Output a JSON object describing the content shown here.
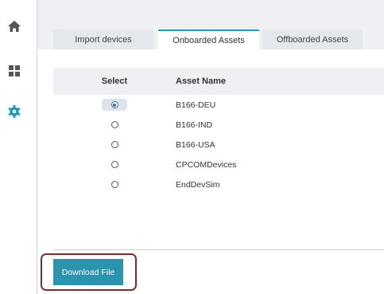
{
  "sidebar": {
    "items": [
      {
        "icon": "home-icon"
      },
      {
        "icon": "dashboard-icon"
      },
      {
        "icon": "gear-icon",
        "active_color": "#1a9bb5"
      }
    ]
  },
  "tabs": [
    {
      "label": "Import devices",
      "active": false
    },
    {
      "label": "Onboarded Assets",
      "active": true
    },
    {
      "label": "Offboarded Assets",
      "active": false
    }
  ],
  "table": {
    "headers": {
      "select": "Select",
      "name": "Asset Name"
    },
    "rows": [
      {
        "name": "B166-DEU",
        "selected": true
      },
      {
        "name": "B166-IND",
        "selected": false
      },
      {
        "name": "B166-USA",
        "selected": false
      },
      {
        "name": "CPCOMDevices",
        "selected": false
      },
      {
        "name": "EndDevSim",
        "selected": false
      }
    ]
  },
  "actions": {
    "download_label": "Download File"
  },
  "colors": {
    "accent": "#2c93ad",
    "highlight": "#7a2f2f",
    "header_bg": "#eef0f3"
  }
}
